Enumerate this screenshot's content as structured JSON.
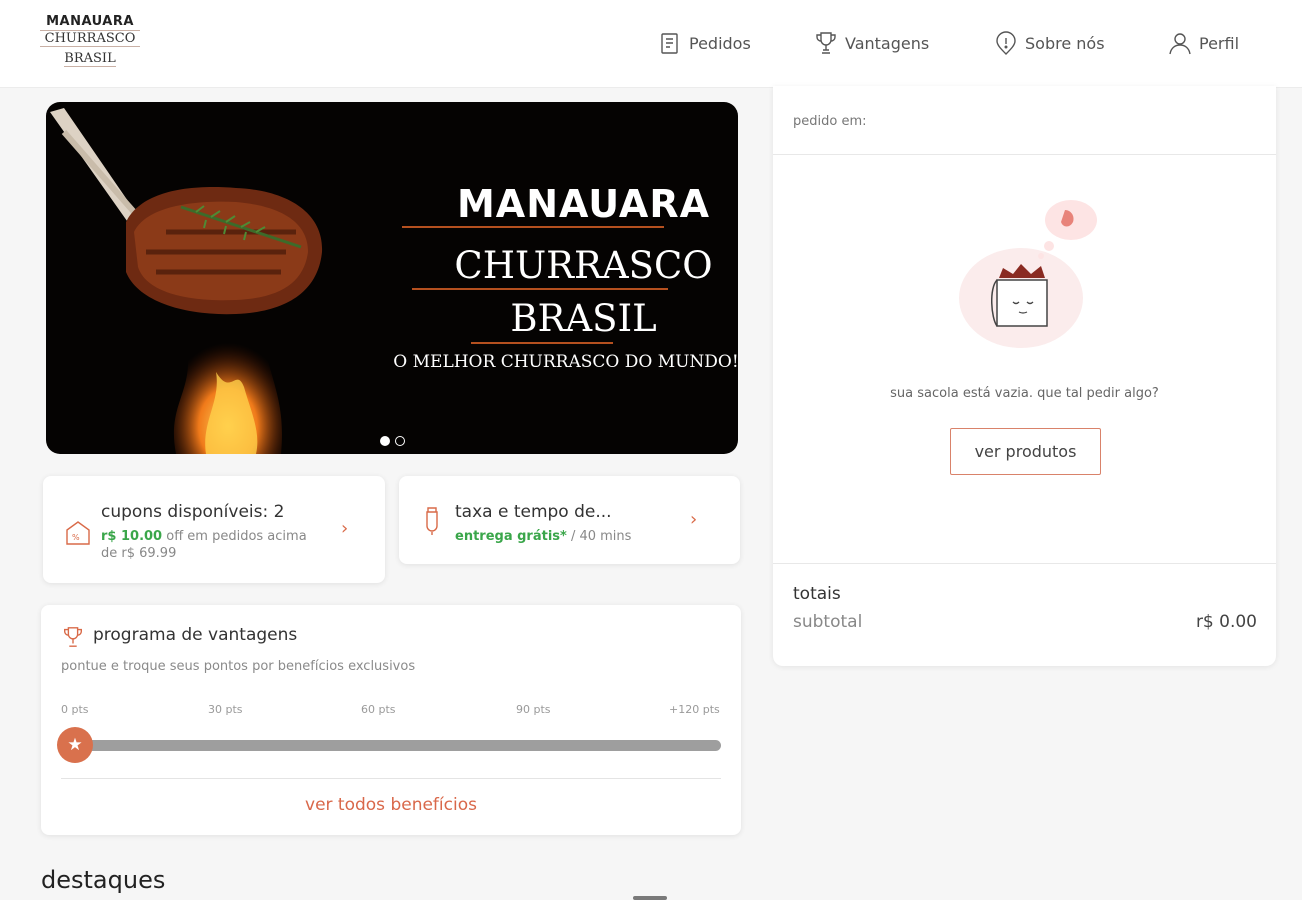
{
  "logo": {
    "line1": "MANAUARA",
    "line2": "CHURRASCO",
    "line3": "BRASIL"
  },
  "nav": [
    {
      "label": "Pedidos",
      "icon": "receipt-icon"
    },
    {
      "label": "Vantagens",
      "icon": "trophy-icon"
    },
    {
      "label": "Sobre nós",
      "icon": "info-pin-icon"
    },
    {
      "label": "Perfil",
      "icon": "user-icon"
    }
  ],
  "banner": {
    "title1": "MANAUARA",
    "title2": "CHURRASCO",
    "title3": "BRASIL",
    "subtitle": "O MELHOR CHURRASCO DO MUNDO!",
    "slides": 2,
    "active_slide": 1
  },
  "coupons": {
    "title": "cupons disponíveis: 2",
    "amount": "r$ 10.00",
    "off_text": " off em pedidos acima",
    "min_text": "de r$ 69.99",
    "icon": "coupon-icon"
  },
  "delivery": {
    "title": "taxa e tempo de...",
    "free": "entrega grátis*",
    "time": " / 40 mins",
    "icon": "delivery-icon"
  },
  "vantagens": {
    "title": "programa de vantagens",
    "description": "pontue e troque seus pontos por benefícios exclusivos",
    "ticks": [
      "0 pts",
      "30 pts",
      "60 pts",
      "90 pts",
      "+120 pts"
    ],
    "progress": 0,
    "link": "ver todos benefícios"
  },
  "section_title": "destaques",
  "cart": {
    "header": "pedido em:",
    "empty_message": "sua sacola está vazia. que tal pedir algo?",
    "button": "ver produtos",
    "totals_label": "totais",
    "subtotal_label": "subtotal",
    "subtotal_value": "r$ 0.00"
  },
  "colors": {
    "accent": "#d9684a",
    "green": "#3aa64a",
    "banner_bg": "#050302"
  }
}
